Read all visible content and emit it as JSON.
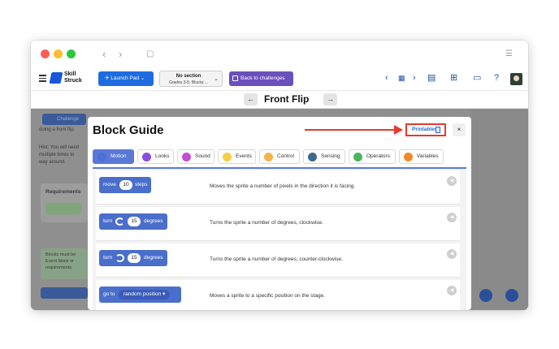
{
  "app": {
    "logo_line1": "Skill",
    "logo_line2": "Struck"
  },
  "toolbar": {
    "launch_pad": "Launch Pad",
    "section_title": "No section",
    "section_subtitle": "Grades 3-5: Blocks ...",
    "back_to_challenges": "Back to challenges"
  },
  "level": {
    "title": "Front Flip"
  },
  "background": {
    "challenge_tab": "Challenge",
    "lines": [
      "doing a front flip",
      "Hint: You will need",
      "multiple times to",
      "way around."
    ],
    "requirements": "Requirements",
    "blocks_note": [
      "Blocks must be",
      "Event block or",
      "requirements"
    ]
  },
  "modal": {
    "title": "Block Guide",
    "printables": "Printables",
    "close": "×",
    "tabs": [
      {
        "label": "Motion",
        "color": "#4c6fd8",
        "active": true
      },
      {
        "label": "Looks",
        "color": "#8a4fe0",
        "active": false
      },
      {
        "label": "Sound",
        "color": "#c44fd2",
        "active": false
      },
      {
        "label": "Events",
        "color": "#f7cd42",
        "active": false
      },
      {
        "label": "Control",
        "color": "#f7b24e",
        "active": false
      },
      {
        "label": "Sensing",
        "color": "#3b6a8f",
        "active": false
      },
      {
        "label": "Operators",
        "color": "#4bb55a",
        "active": false
      },
      {
        "label": "Variables",
        "color": "#f0892b",
        "active": false
      }
    ],
    "blocks": [
      {
        "parts": [
          "move",
          "10",
          "steps"
        ],
        "description": "Moves the sprite a number of pixels in the direction it is facing."
      },
      {
        "parts": [
          "turn",
          "15",
          "degrees"
        ],
        "description": "Turns the sprite a number of degrees, clockwise."
      },
      {
        "parts": [
          "turn",
          "15",
          "degrees"
        ],
        "description": "Turns the sprite a number of degrees, counter-clockwise."
      },
      {
        "parts": [
          "go to",
          "random position"
        ],
        "description": "Moves a sprite to a specific position on the stage."
      }
    ]
  },
  "colors": {
    "accent": "#1f6be0",
    "highlight": "#e53b2c",
    "challenges_button": "#6b4fbb",
    "block": "#4a6ecb"
  }
}
